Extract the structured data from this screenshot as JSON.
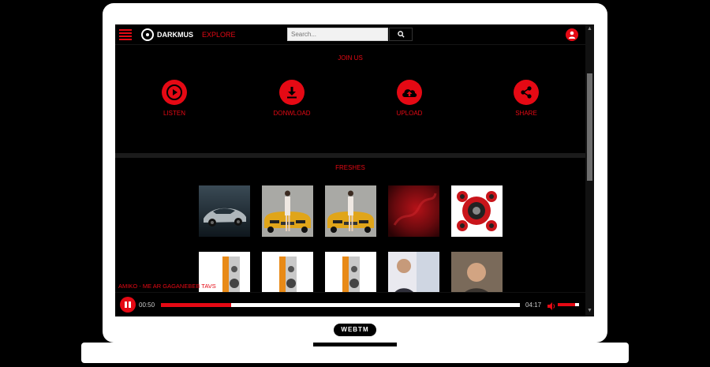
{
  "header": {
    "logo_text": "DARKMUS",
    "explore_label": "EXPLORE",
    "search_placeholder": "Search..."
  },
  "join": {
    "title": "JOIN US",
    "features": [
      {
        "label": "LISTEN",
        "icon": "play-icon"
      },
      {
        "label": "DONWLOAD",
        "icon": "download-icon"
      },
      {
        "label": "UPLOAD",
        "icon": "upload-cloud-icon"
      },
      {
        "label": "SHARE",
        "icon": "share-icon"
      }
    ]
  },
  "freshes": {
    "title": "FRESHES",
    "thumbnails": [
      {
        "name": "thumb-silver-sports-car"
      },
      {
        "name": "thumb-yellow-car-model"
      },
      {
        "name": "thumb-yellow-car-model"
      },
      {
        "name": "thumb-red-smoke"
      },
      {
        "name": "thumb-red-speakers"
      },
      {
        "name": "thumb-orange-speaker"
      },
      {
        "name": "thumb-orange-speaker"
      },
      {
        "name": "thumb-orange-speaker"
      },
      {
        "name": "thumb-man-portrait"
      },
      {
        "name": "thumb-man-portrait"
      }
    ]
  },
  "player": {
    "now_playing": "AMIKO - ME AR GAGANEBEB TAVS",
    "current_time": "00:50",
    "duration": "04:17",
    "progress": 0.195,
    "volume": 0.8
  },
  "device": {
    "brand": "WEBTM"
  },
  "colors": {
    "accent": "#e50914",
    "background": "#000000"
  }
}
